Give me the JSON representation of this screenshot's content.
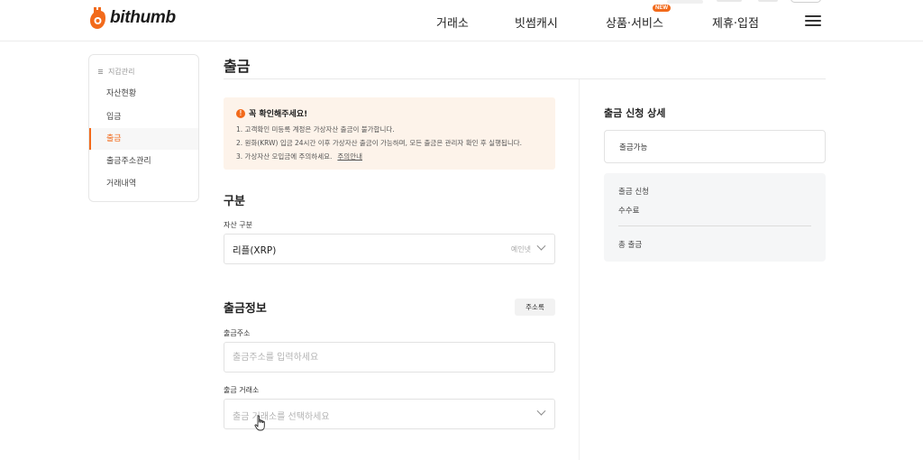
{
  "header": {
    "brand": "bithumb",
    "nav": [
      "거래소",
      "빗썸캐시",
      "상품·서비스",
      "제휴·입점"
    ],
    "new_badge": "NEW",
    "accent": "#f26a1b"
  },
  "sidebar": {
    "title": "지갑관리",
    "items": [
      {
        "label": "자산현황",
        "active": false
      },
      {
        "label": "입금",
        "active": false
      },
      {
        "label": "출금",
        "active": true
      },
      {
        "label": "출금주소관리",
        "active": false
      },
      {
        "label": "거래내역",
        "active": false
      }
    ]
  },
  "page": {
    "title": "출금"
  },
  "notice": {
    "heading": "꼭 확인해주세요!",
    "icon": "warning-icon",
    "lines": [
      "1. 고객확인 미등록 계정은 가상자산 출금이 불가합니다.",
      "2. 원화(KRW) 입금 24시간 이후 가상자산 출금이 가능하며, 모든 출금은 관리자 확인 후 실행됩니다.",
      "3. 가상자산 오입금에 주의하세요."
    ],
    "link": "주의안내"
  },
  "category": {
    "section_title": "구분",
    "asset_label": "자산 구분",
    "asset_value": "리플(XRP)",
    "asset_sub": "예인넷"
  },
  "withdraw_info": {
    "section_title": "출금정보",
    "address_book_button": "주소록",
    "address_label": "출금주소",
    "address_placeholder": "출금주소를 입력하세요",
    "exchange_label": "출금 거래소",
    "exchange_placeholder": "출금 거래소를 선택하세요"
  },
  "detail": {
    "title": "출금 신청 상세",
    "available_label": "출금가능",
    "request_label": "출금 신청",
    "fee_label": "수수료",
    "total_label": "총 출금"
  }
}
